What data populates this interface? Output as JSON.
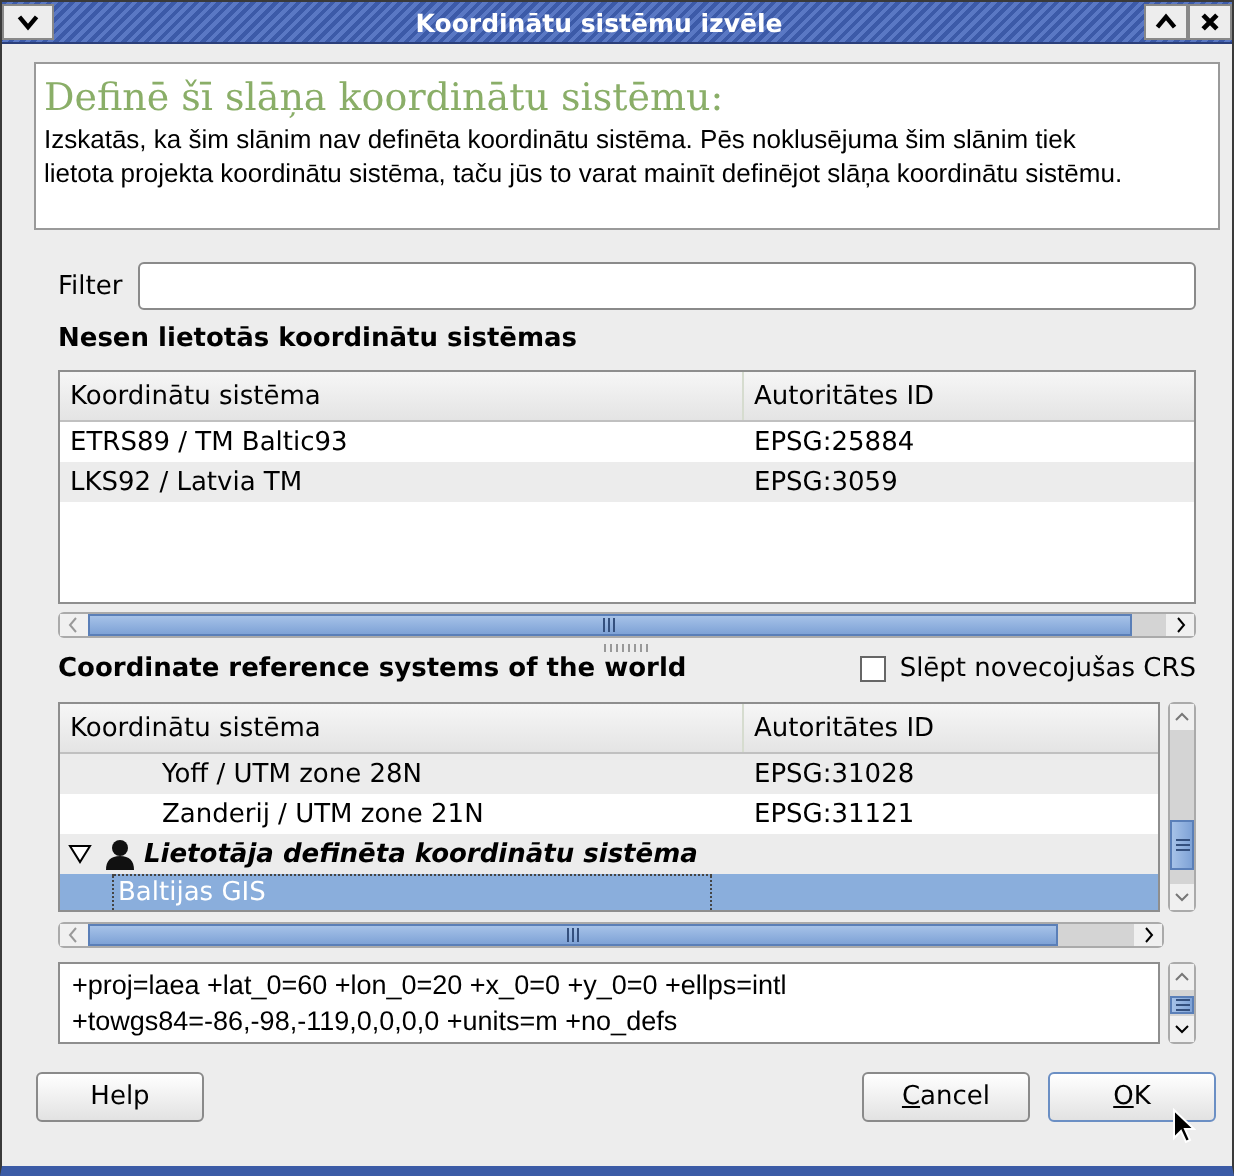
{
  "window": {
    "title": "Koordinātu sistēmu izvēle"
  },
  "info": {
    "heading": "Definē šī slāņa koordinātu sistēmu:",
    "text": "Izskatās, ka šim slānim nav definēta koordinātu sistēma. Pēs noklusējuma šim slānim tiek lietota projekta koordinātu sistēma, taču jūs to varat mainīt definējot slāņa koordinātu sistēmu."
  },
  "filter": {
    "label": "Filter"
  },
  "recent": {
    "heading": "Nesen lietotās koordinātu sistēmas",
    "columns": [
      "Koordinātu sistēma",
      "Autoritātes ID"
    ],
    "rows": [
      {
        "name": "ETRS89 / TM Baltic93",
        "id": "EPSG:25884",
        "selected": false
      },
      {
        "name": "LKS92 / Latvia TM",
        "id": "EPSG:3059",
        "selected": false
      }
    ]
  },
  "world": {
    "heading": "Coordinate reference systems of the world",
    "hide_deprecated": {
      "label": "Slēpt novecojušas CRS",
      "checked": false
    },
    "columns": [
      "Koordinātu sistēma",
      "Autoritātes ID"
    ],
    "rows": [
      {
        "kind": "continuation",
        "children": [
          {
            "kind": "continuation",
            "children": [
              {
                "kind": "item",
                "name": "Yoff / UTM zone 28N",
                "id": "EPSG:31028",
                "selected": false
              },
              {
                "kind": "item",
                "name": "Zanderij / UTM zone 21N",
                "id": "EPSG:31121",
                "selected": false
              }
            ]
          }
        ]
      },
      {
        "kind": "group",
        "name": "Lietotāja definēta koordinātu sistēma",
        "expanded": true,
        "children": [
          {
            "kind": "item",
            "name": "Baltijas GIS",
            "selected": true
          }
        ]
      }
    ]
  },
  "proj_lines": [
    "+proj=laea +lat_0=60 +lon_0=20 +x_0=0 +y_0=0 +ellps=intl",
    "+towgs84=-86,-98,-119,0,0,0,0 +units=m +no_defs"
  ],
  "buttons": [
    {
      "label": "Help",
      "mnemonic": false,
      "default": false
    },
    {
      "label": "Cancel",
      "mnemonic": true,
      "default": false
    },
    {
      "label": "OK",
      "mnemonic": true,
      "default": true
    }
  ]
}
